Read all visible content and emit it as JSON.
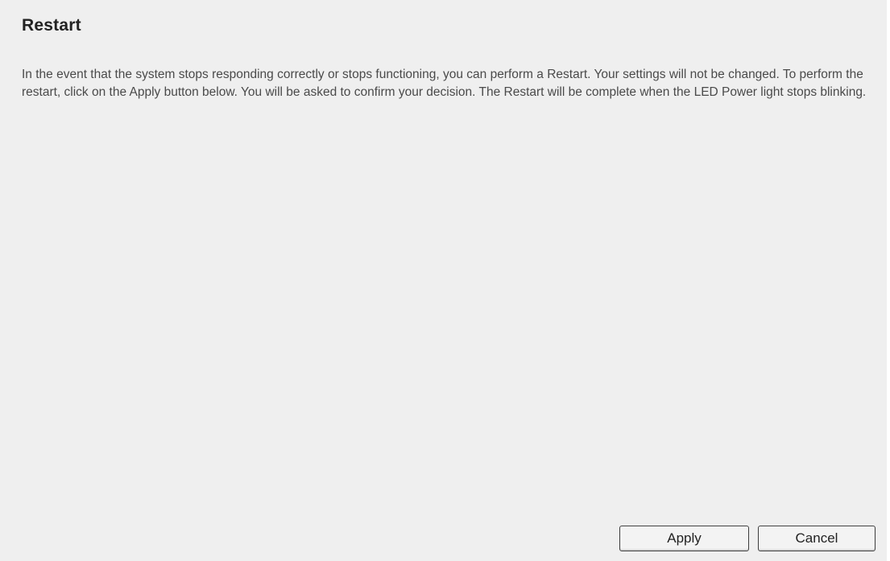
{
  "page": {
    "title": "Restart",
    "description": "In the event that the system stops responding correctly or stops functioning, you can perform a Restart. Your settings will not be changed. To perform the restart, click on the Apply button below. You will be asked to confirm your decision. The Restart will be complete when the LED Power light stops blinking."
  },
  "actions": {
    "apply_label": "Apply",
    "cancel_label": "Cancel"
  }
}
